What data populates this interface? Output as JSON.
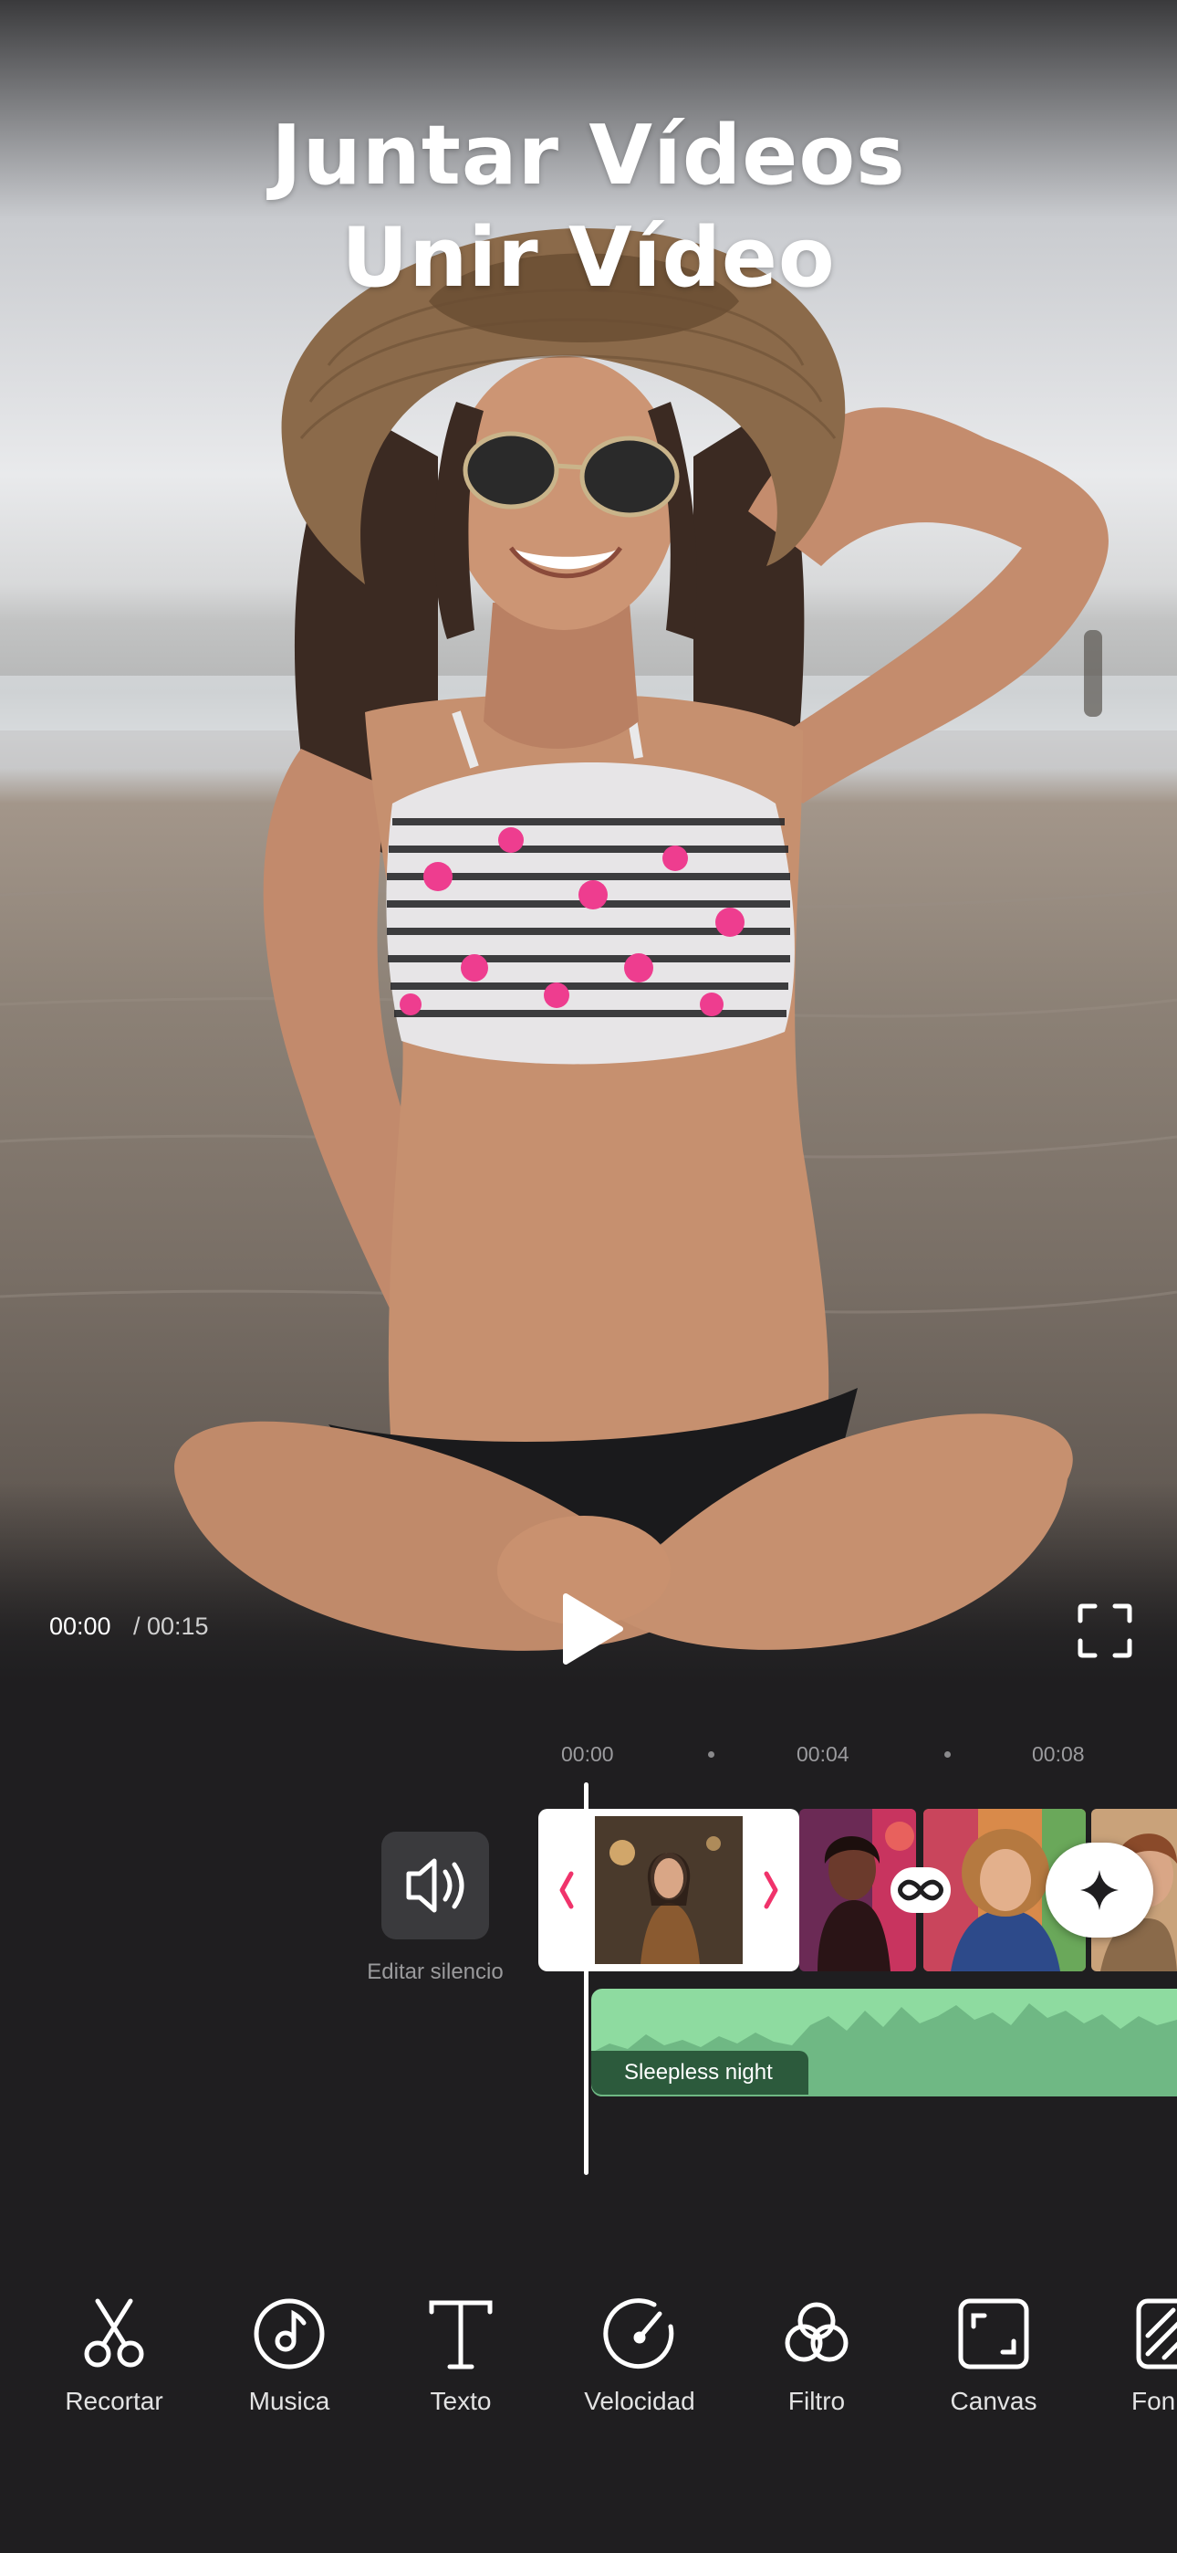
{
  "headline": {
    "line1": "Juntar Vídeos",
    "line2": "Unir Vídeo"
  },
  "player": {
    "current_time": "00:00",
    "total_time": "/ 00:15",
    "play_icon": "play-icon",
    "fullscreen_icon": "fullscreen-icon"
  },
  "timeline": {
    "ruler": [
      "00:00",
      "00:04",
      "00:08"
    ],
    "mute_label": "Editar silencio",
    "mute_icon": "speaker-icon",
    "transition_icon": "infinity-icon",
    "add_icon": "plus-sparkle-icon",
    "audio_track_name": "Sleepless night",
    "audio_color": "#8edba0",
    "handle_color": "#f0336b"
  },
  "toolbar": {
    "items": [
      {
        "label": "Recortar",
        "icon": "scissors-icon"
      },
      {
        "label": "Musica",
        "icon": "music-note-icon"
      },
      {
        "label": "Texto",
        "icon": "text-icon"
      },
      {
        "label": "Velocidad",
        "icon": "speedometer-icon"
      },
      {
        "label": "Filtro",
        "icon": "filter-icon"
      },
      {
        "label": "Canvas",
        "icon": "canvas-icon"
      },
      {
        "label": "Fon",
        "icon": "background-icon"
      }
    ]
  },
  "colors": {
    "background": "#1f1e20",
    "accent_pink": "#f0336b"
  }
}
